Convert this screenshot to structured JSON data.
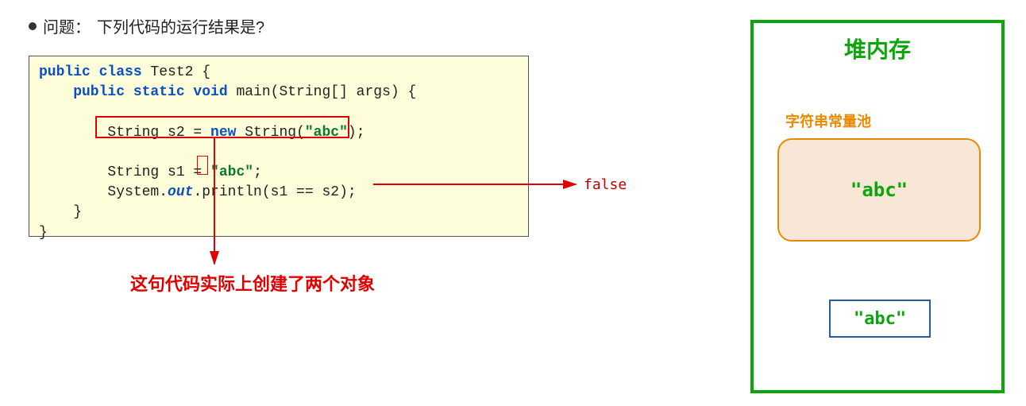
{
  "question": {
    "label": "问题：",
    "text": "下列代码的运行结果是?"
  },
  "code": {
    "line1_pre": "public class",
    "line1_post": " Test2 {",
    "line2_pre": "    public static void",
    "line2_post": " main(String[] args) {",
    "line3": "",
    "line4_a": "        String s2 = ",
    "line4_b": "new",
    "line4_c": " String(",
    "line4_d": "\"abc\"",
    "line4_e": ");",
    "line5": "",
    "line6_a": "        String s1 = ",
    "line6_b": "\"abc\"",
    "line6_c": ";",
    "line7_a": "        System.",
    "line7_b": "out",
    "line7_c": ".println(s1 == s2);",
    "line8": "    }",
    "line9": "}"
  },
  "result": {
    "false_label": "false",
    "annotation": "这句代码实际上创建了两个对象"
  },
  "heap": {
    "title": "堆内存",
    "pool_label": "字符串常量池",
    "pool_value": "\"abc\"",
    "object_value": "\"abc\""
  }
}
